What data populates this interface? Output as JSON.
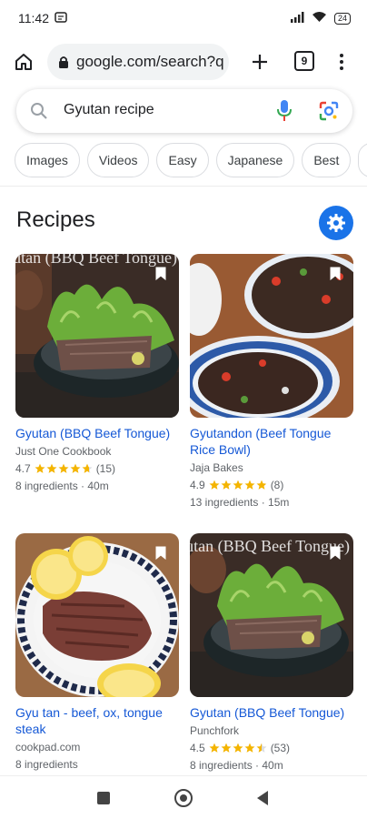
{
  "status_bar": {
    "time": "11:42",
    "battery": "24"
  },
  "browser": {
    "url": "google.com/search?q",
    "tab_count": "9"
  },
  "search": {
    "query": "Gyutan recipe"
  },
  "chips": [
    "Images",
    "Videos",
    "Easy",
    "Japanese",
    "Best"
  ],
  "recipes": {
    "title": "Recipes",
    "cards": [
      {
        "title": "Gyutan (BBQ Beef Tongue)",
        "source": "Just One Cookbook",
        "rating": "4.7",
        "stars": 4.7,
        "reviews": "(15)",
        "meta": "8 ingredients · 40m",
        "image_label": "Gyutan (BBQ Beef Tongue)"
      },
      {
        "title": "Gyutandon (Beef Tongue Rice Bowl)",
        "source": "Jaja Bakes",
        "rating": "4.9",
        "stars": 4.9,
        "reviews": "(8)",
        "meta": "13 ingredients · 15m",
        "image_label": ""
      },
      {
        "title": "Gyu tan - beef, ox, tongue steak",
        "source": "cookpad.com",
        "rating": "",
        "stars": 0,
        "reviews": "",
        "meta": "8 ingredients",
        "image_label": ""
      },
      {
        "title": "Gyutan (BBQ Beef Tongue)",
        "source": "Punchfork",
        "rating": "4.5",
        "stars": 4.5,
        "reviews": "(53)",
        "meta": "8 ingredients · 40m",
        "image_label": "Gyutan (BBQ Beef Tongue)"
      }
    ]
  },
  "colors": {
    "link": "#1558d6",
    "star": "#f4b400",
    "accent": "#1a73e8"
  }
}
